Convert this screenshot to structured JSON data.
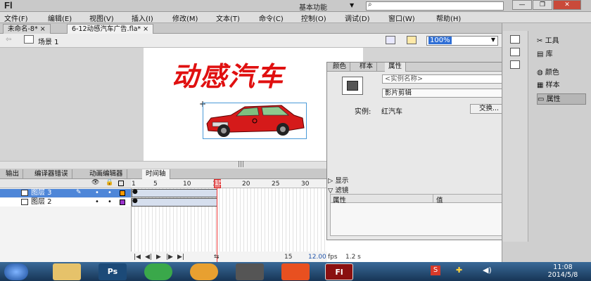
{
  "app": {
    "logo": "Fl",
    "workspace": "基本功能",
    "workspace_arrow": "▼"
  },
  "window_controls": [
    "—",
    "❐",
    "✕"
  ],
  "menu": [
    "文件(F)",
    "编辑(E)",
    "视图(V)",
    "插入(I)",
    "修改(M)",
    "文本(T)",
    "命令(C)",
    "控制(O)",
    "调试(D)",
    "窗口(W)",
    "帮助(H)"
  ],
  "doc_tabs": [
    {
      "label": "未命名-8*",
      "close": "×"
    },
    {
      "label": "6-12动感汽车广告.fla*",
      "close": "×"
    }
  ],
  "editbar": {
    "back": "⇦",
    "scene": "场景 1",
    "zoom": "100%"
  },
  "stage": {
    "title_text": "动感汽车"
  },
  "panel_tabs": [
    "输出",
    "编译器错误",
    "动画编辑器",
    "时间轴"
  ],
  "timeline": {
    "layers": [
      {
        "name": "图层 3",
        "selected": true,
        "color": "#ff9a00"
      },
      {
        "name": "图层 2",
        "selected": false,
        "color": "#9a33cc"
      }
    ],
    "frame_numbers": [
      "1",
      "5",
      "10",
      "15",
      "20",
      "25",
      "30"
    ],
    "playhead_frame": "15",
    "current_frame": "15",
    "fps": "12.00",
    "fps_unit": "fps",
    "time": "1.2 s"
  },
  "properties": {
    "tabs": [
      "颜色",
      "样本",
      "属性"
    ],
    "instance_name_placeholder": "<实例名称>",
    "symbol_type": "影片剪辑",
    "instance_label": "实例:",
    "instance_value": "红汽车",
    "swap_button": "交换...",
    "sections": [
      "显示",
      "滤镜"
    ],
    "filter_columns": [
      "属性",
      "值"
    ]
  },
  "right_panel": {
    "items": [
      {
        "label": "工具",
        "icon": "tools-icon"
      },
      {
        "label": "库",
        "icon": "library-icon"
      },
      {
        "label": "颜色",
        "icon": "color-icon"
      },
      {
        "label": "样本",
        "icon": "swatches-icon"
      },
      {
        "label": "属性",
        "icon": "properties-icon"
      }
    ]
  },
  "taskbar": {
    "apps": [
      "Ps",
      "Fl"
    ],
    "time": "11:08",
    "date": "2014/5/8",
    "tray_lang": "S"
  }
}
